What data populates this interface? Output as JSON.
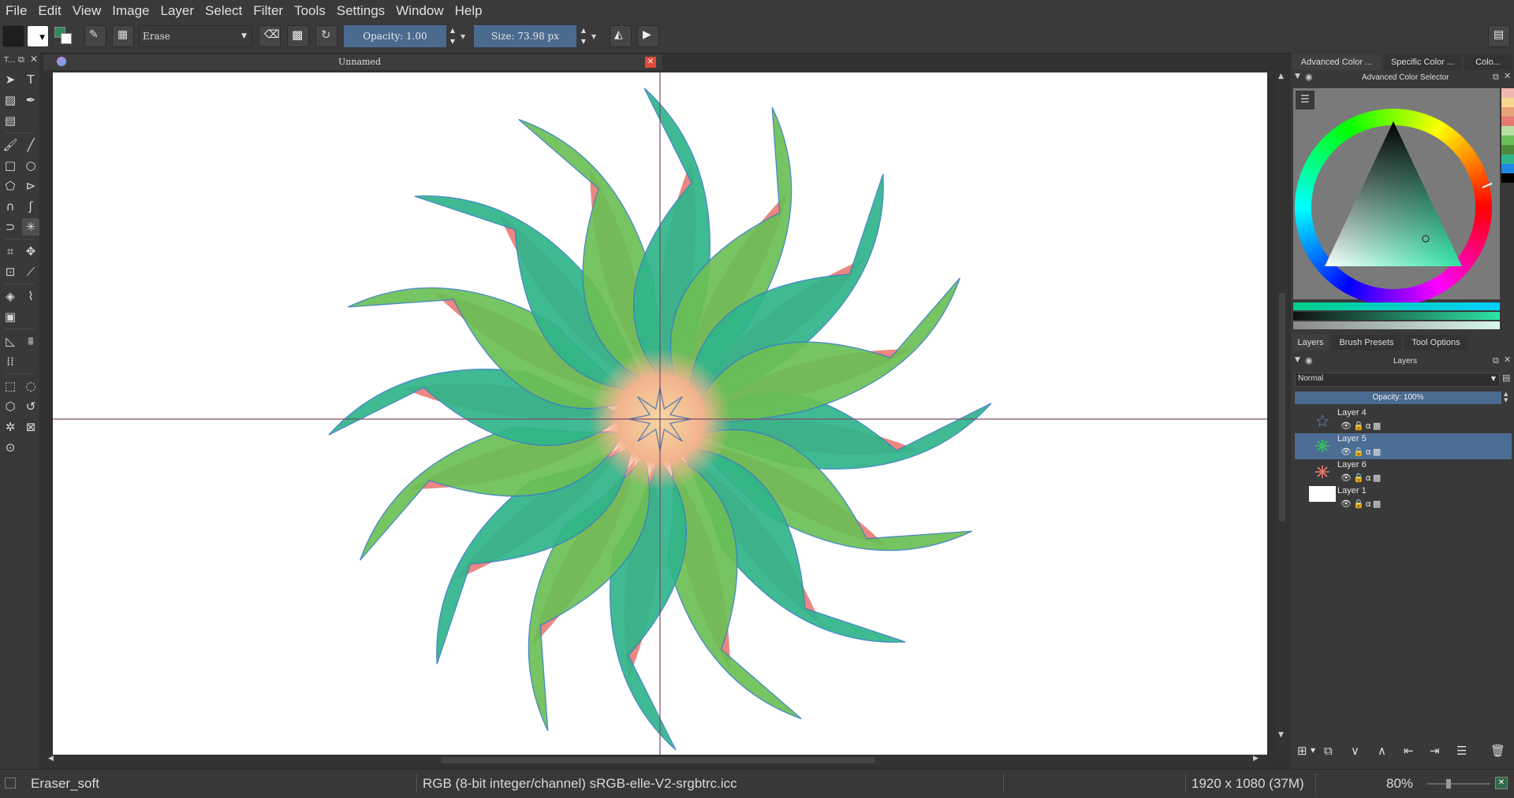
{
  "menubar": {
    "items": [
      "File",
      "Edit",
      "View",
      "Image",
      "Layer",
      "Select",
      "Filter",
      "Tools",
      "Settings",
      "Window",
      "Help"
    ]
  },
  "toolbar": {
    "blend_mode": "Erase",
    "opacity_label": "Opacity:  1.00",
    "size_label": "Size:  73.98 px"
  },
  "toolbox": {
    "header": "T..."
  },
  "document": {
    "tab_title": "Unnamed"
  },
  "docker": {
    "color_tabs": [
      "Advanced Color ...",
      "Specific Color ...",
      "Colo..."
    ],
    "color_panel_title": "Advanced Color Selector",
    "layer_tabs": [
      "Layers",
      "Brush Presets",
      "Tool Options"
    ],
    "layers_panel_title": "Layers",
    "blend_mode": "Normal",
    "opacity_label": "Opacity:  100%",
    "layers": [
      {
        "name": "Layer 4",
        "selected": false
      },
      {
        "name": "Layer 5",
        "selected": true
      },
      {
        "name": "Layer 6",
        "selected": false
      },
      {
        "name": "Layer 1",
        "selected": false
      }
    ]
  },
  "statusbar": {
    "brush": "Eraser_soft",
    "color_profile": "RGB (8-bit integer/channel)  sRGB-elle-V2-srgbtrc.icc",
    "image_size": "1920 x 1080 (37M)",
    "zoom": "80%"
  },
  "colors": {
    "accent": "#4b6a8f",
    "selected_layer": "#4c6d94",
    "leaf_green": "#6cbf55",
    "leaf_teal": "#2fb58a",
    "petal_red": "#e97a72"
  }
}
